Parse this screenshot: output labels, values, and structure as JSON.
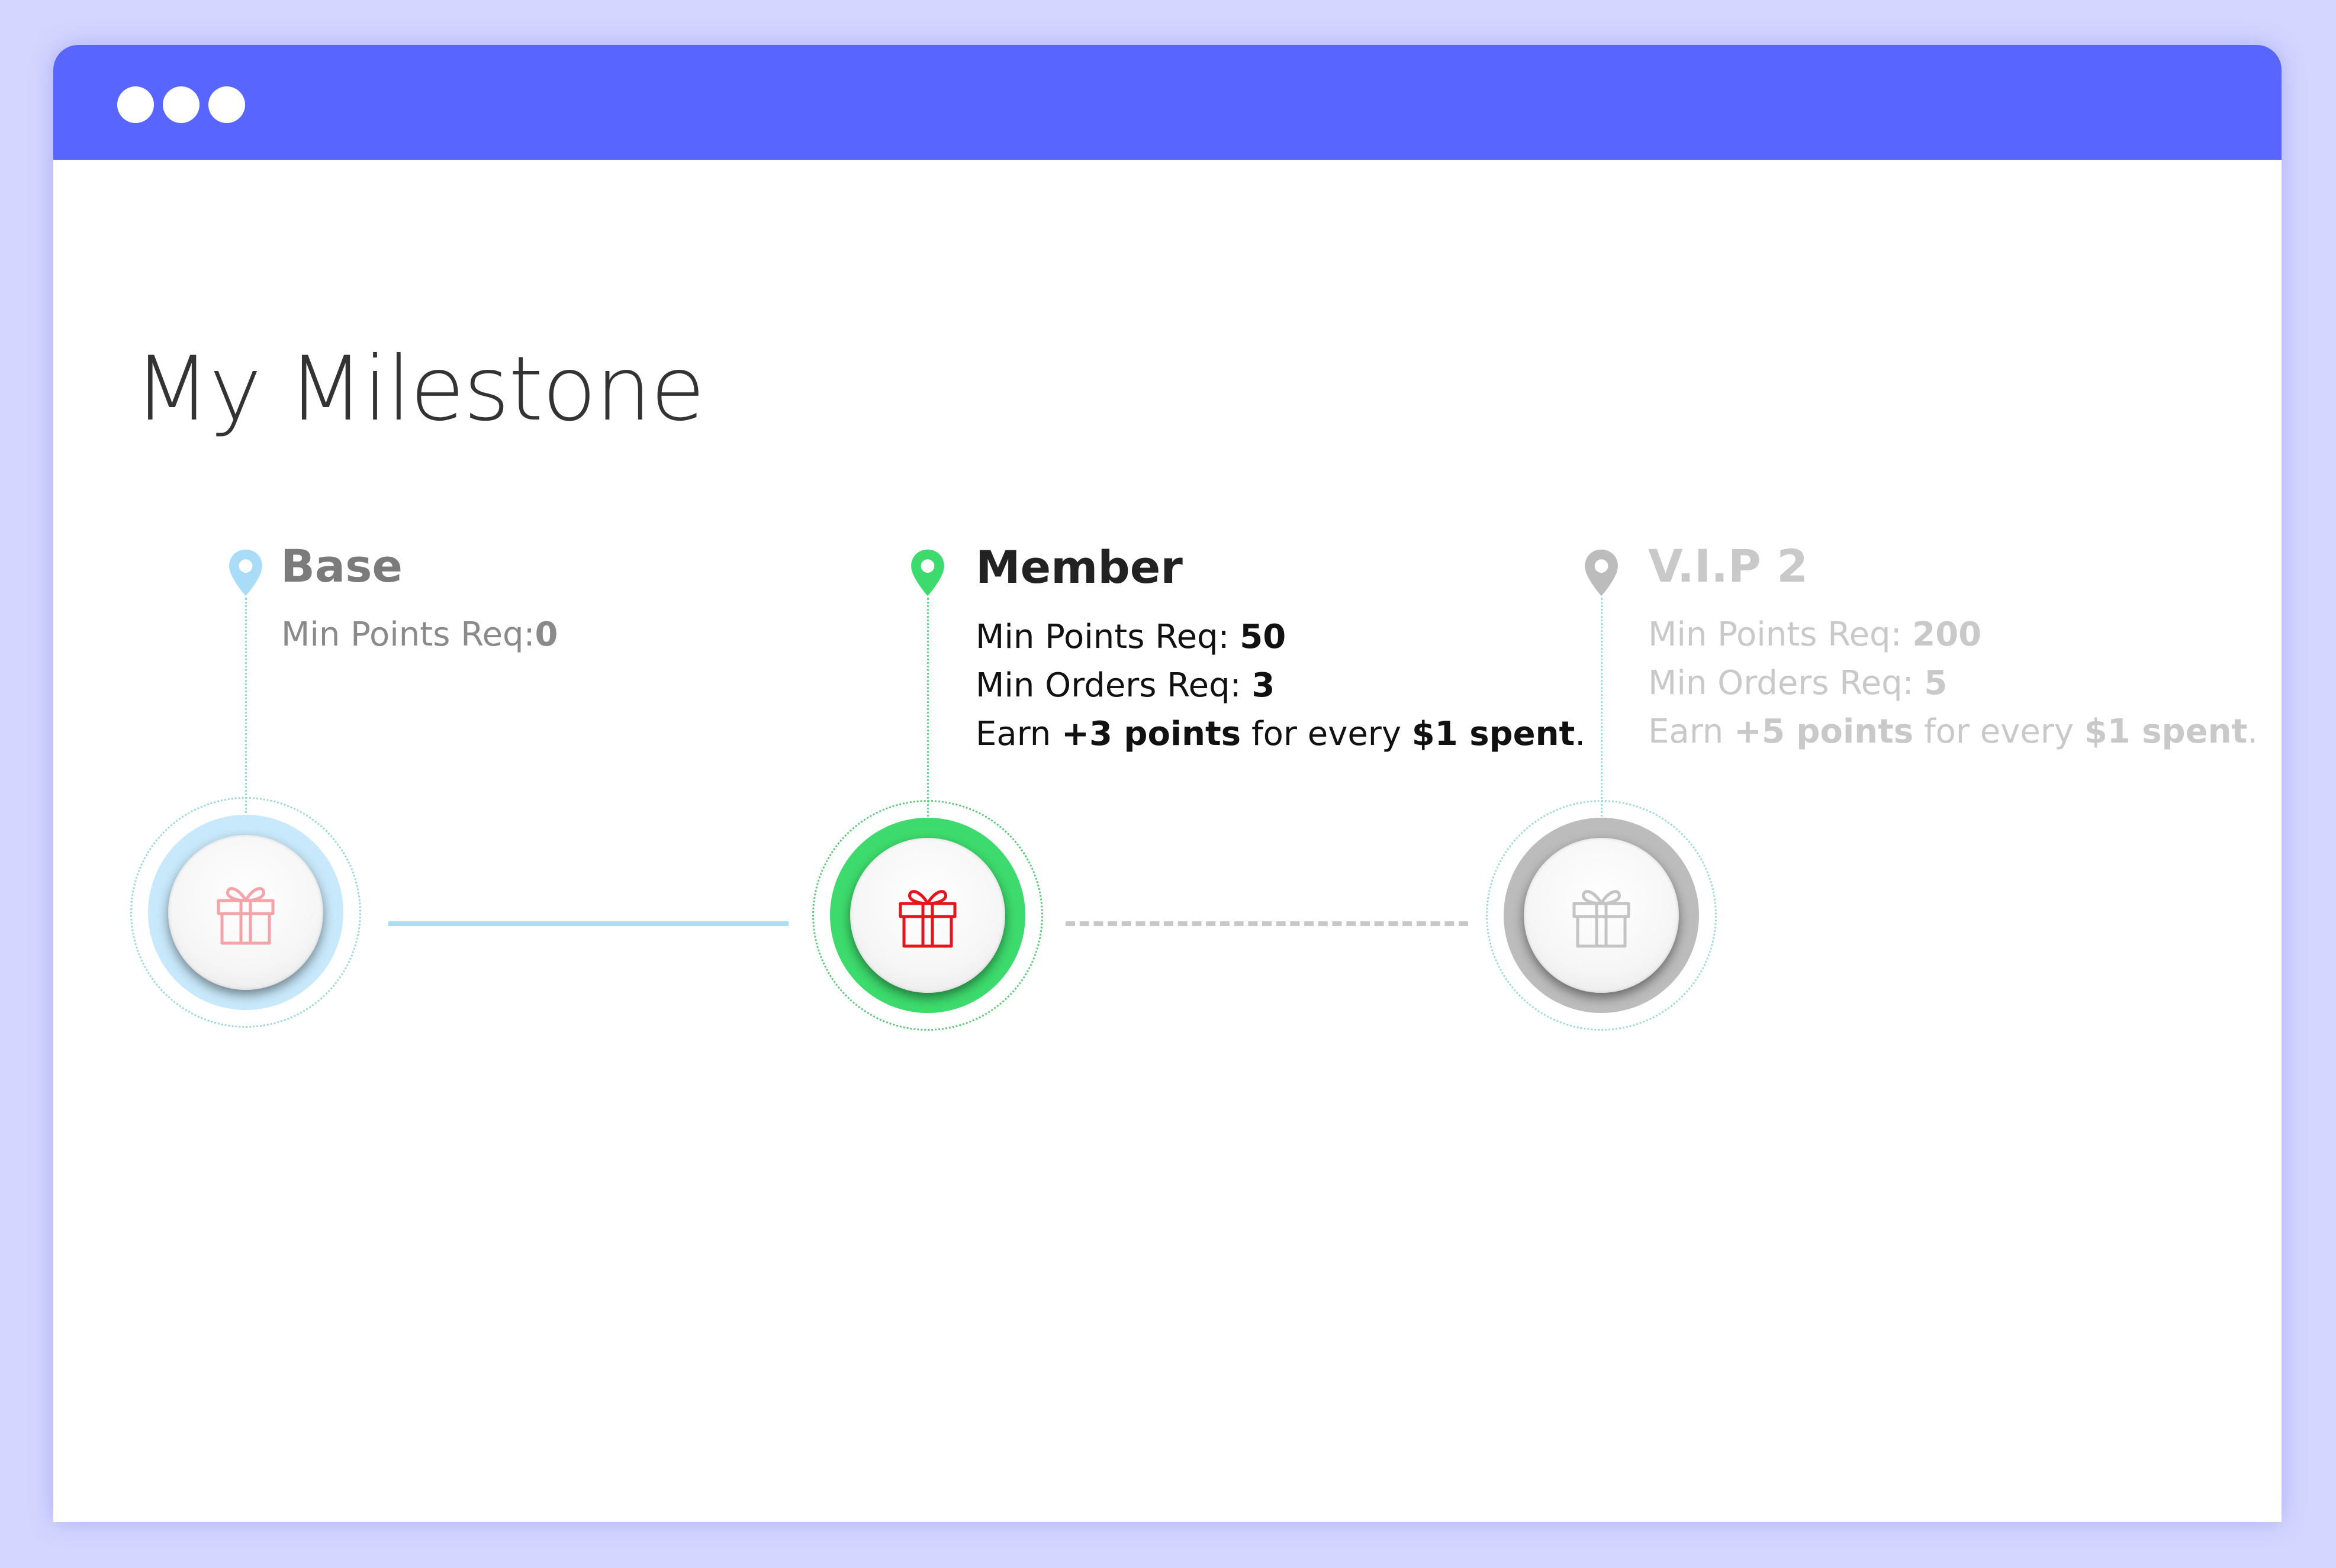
{
  "window": {
    "titlebar_color": "#5965ff",
    "controls": [
      "dot",
      "dot",
      "dot"
    ]
  },
  "page": {
    "title": "My Milestone"
  },
  "milestones": [
    {
      "name": "Base",
      "status": "completed",
      "color": "#a8dcf8",
      "pin_icon": "location-pin-icon",
      "gift_icon": "gift-icon",
      "min_points_label": "Min Points Req:",
      "min_points_value": "0"
    },
    {
      "name": "Member",
      "status": "current",
      "color": "#3ddb6d",
      "pin_icon": "location-pin-icon",
      "gift_icon": "gift-icon",
      "min_points_label": "Min Points Req: ",
      "min_points_value": "50",
      "min_orders_label": "Min Orders Req: ",
      "min_orders_value": "3",
      "earn_prefix": "Earn ",
      "earn_points": "+3 points",
      "earn_middle": " for every ",
      "earn_spent": "$1 spent",
      "earn_suffix": "."
    },
    {
      "name": "V.I.P 2",
      "status": "locked",
      "color": "#bcbcbc",
      "pin_icon": "location-pin-icon",
      "gift_icon": "gift-icon",
      "min_points_label": "Min Points Req: ",
      "min_points_value": "200",
      "min_orders_label": "Min Orders Req: ",
      "min_orders_value": "5",
      "earn_prefix": "Earn ",
      "earn_points": "+5 points",
      "earn_middle": " for every ",
      "earn_spent": "$1 spent",
      "earn_suffix": "."
    }
  ]
}
